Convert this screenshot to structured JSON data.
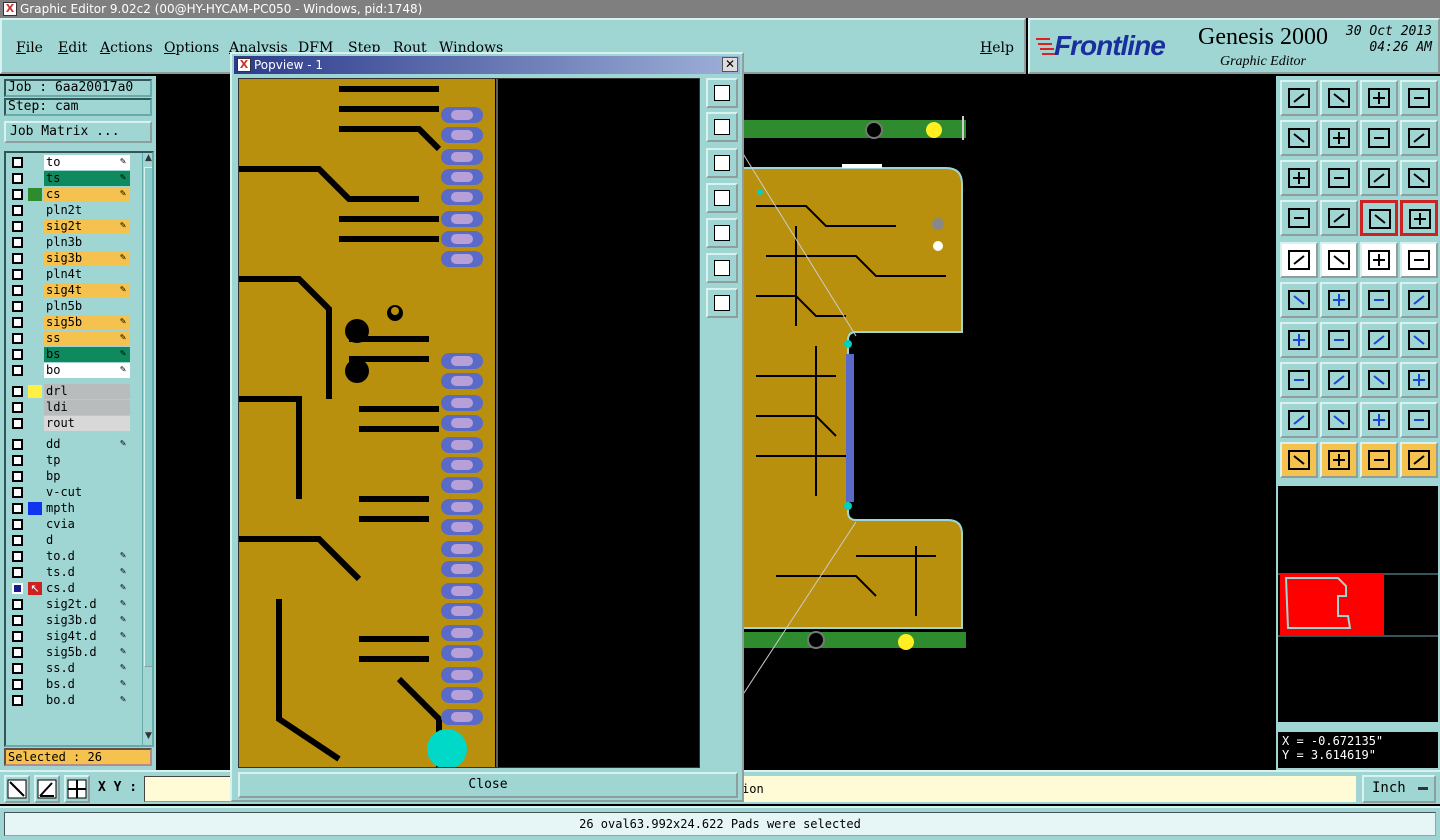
{
  "window": {
    "title": "Graphic Editor 9.02c2 (00@HY-HYCAM-PC050 - Windows, pid:1748)"
  },
  "menu": {
    "items": [
      "File",
      "Edit",
      "Actions",
      "Options",
      "Analysis",
      "DFM",
      "Step",
      "Rout",
      "Windows"
    ],
    "help": "Help"
  },
  "branding": {
    "logo": "Frontline",
    "product": "Genesis 2000",
    "subtitle": "Graphic Editor",
    "date": "30 Oct 2013",
    "time": "04:26 AM"
  },
  "job": {
    "job_label": "Job :",
    "job_value": "6aa20017a0",
    "step_label": "Step:",
    "step_value": "cam",
    "matrix_button": "Job Matrix ..."
  },
  "layers": [
    {
      "name": "to",
      "bg": "#ffffff",
      "swatch": "",
      "edit": true
    },
    {
      "name": "ts",
      "bg": "#0e8a5e",
      "swatch": "",
      "edit": true
    },
    {
      "name": "cs",
      "bg": "#f6c24f",
      "swatch": "#2e8b2e",
      "edit": true
    },
    {
      "name": "pln2t",
      "bg": "#9fd6d3",
      "swatch": "",
      "edit": false
    },
    {
      "name": "sig2t",
      "bg": "#f6c24f",
      "swatch": "",
      "edit": true
    },
    {
      "name": "pln3b",
      "bg": "#9fd6d3",
      "swatch": "",
      "edit": false
    },
    {
      "name": "sig3b",
      "bg": "#f6c24f",
      "swatch": "",
      "edit": true
    },
    {
      "name": "pln4t",
      "bg": "#9fd6d3",
      "swatch": "",
      "edit": false
    },
    {
      "name": "sig4t",
      "bg": "#f6c24f",
      "swatch": "",
      "edit": true
    },
    {
      "name": "pln5b",
      "bg": "#9fd6d3",
      "swatch": "",
      "edit": false
    },
    {
      "name": "sig5b",
      "bg": "#f6c24f",
      "swatch": "",
      "edit": true
    },
    {
      "name": "ss",
      "bg": "#f6c24f",
      "swatch": "",
      "edit": true
    },
    {
      "name": "bs",
      "bg": "#0e8a5e",
      "swatch": "",
      "edit": true
    },
    {
      "name": "bo",
      "bg": "#ffffff",
      "swatch": "",
      "edit": true
    },
    {
      "name": "drl",
      "bg": "#b8bcbc",
      "swatch": "#ffee44",
      "edit": false
    },
    {
      "name": "ldi",
      "bg": "#b8bcbc",
      "swatch": "",
      "edit": false
    },
    {
      "name": "rout",
      "bg": "#d8d8d8",
      "swatch": "",
      "edit": false
    },
    {
      "name": "dd",
      "bg": "#9fd6d3",
      "swatch": "",
      "edit": true
    },
    {
      "name": "tp",
      "bg": "#9fd6d3",
      "swatch": "",
      "edit": false
    },
    {
      "name": "bp",
      "bg": "#9fd6d3",
      "swatch": "",
      "edit": false
    },
    {
      "name": "v-cut",
      "bg": "#9fd6d3",
      "swatch": "",
      "edit": false
    },
    {
      "name": "mpth",
      "bg": "#9fd6d3",
      "swatch": "#1133ee",
      "edit": false
    },
    {
      "name": "cvia",
      "bg": "#9fd6d3",
      "swatch": "",
      "edit": false
    },
    {
      "name": "d",
      "bg": "#9fd6d3",
      "swatch": "",
      "edit": false
    },
    {
      "name": "to.d",
      "bg": "#9fd6d3",
      "swatch": "",
      "edit": true
    },
    {
      "name": "ts.d",
      "bg": "#9fd6d3",
      "swatch": "",
      "edit": true
    },
    {
      "name": "cs.d",
      "bg": "#9fd6d3",
      "swatch": "#cc2222",
      "edit": true,
      "work": true
    },
    {
      "name": "sig2t.d",
      "bg": "#9fd6d3",
      "swatch": "",
      "edit": true
    },
    {
      "name": "sig3b.d",
      "bg": "#9fd6d3",
      "swatch": "",
      "edit": true
    },
    {
      "name": "sig4t.d",
      "bg": "#9fd6d3",
      "swatch": "",
      "edit": true
    },
    {
      "name": "sig5b.d",
      "bg": "#9fd6d3",
      "swatch": "",
      "edit": true
    },
    {
      "name": "ss.d",
      "bg": "#9fd6d3",
      "swatch": "",
      "edit": true
    },
    {
      "name": "bs.d",
      "bg": "#9fd6d3",
      "swatch": "",
      "edit": true
    },
    {
      "name": "bo.d",
      "bg": "#9fd6d3",
      "swatch": "",
      "edit": true
    }
  ],
  "selection": {
    "text": "Selected : 26"
  },
  "popview": {
    "title": "Popview - 1",
    "close_label": "Close"
  },
  "cursor": {
    "x": "X = -0.672135\"",
    "y": "Y = 3.614619\""
  },
  "command": {
    "xy_label": "X Y :",
    "message": "ion",
    "unit": "Inch"
  },
  "status": {
    "text": "26 oval63.992x24.622 Pads were selected"
  },
  "colors": {
    "panel": "#9fd6d3",
    "copper": "#b8900e",
    "selected_pad": "#5a6ac8",
    "pad_inner": "#b7a0d8",
    "solder_mask": "#2e8b2e",
    "minimap_board": "#ff0000"
  }
}
